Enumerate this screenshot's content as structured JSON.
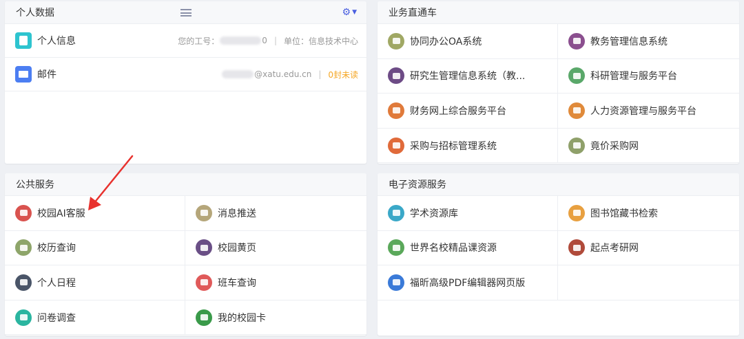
{
  "personal": {
    "title": "个人数据",
    "rows": [
      {
        "icon": "id-card-icon",
        "label": "个人信息",
        "id_prefix": "您的工号：",
        "id_tail": "0",
        "sep": "|",
        "dept": "单位：信息技术中心"
      },
      {
        "icon": "mail-icon",
        "label": "邮件",
        "email_tail": "@xatu.edu.cn",
        "sep": "|",
        "unread": "0封未读"
      }
    ]
  },
  "express": {
    "title": "业务直通车",
    "items": [
      {
        "label": "协同办公OA系统",
        "icon": "briefcase-icon",
        "color": "#a0a864"
      },
      {
        "label": "教务管理信息系统",
        "icon": "monitor-icon",
        "color": "#8b4f8f"
      },
      {
        "label": "研究生管理信息系统（教...",
        "icon": "monitor-icon",
        "color": "#6d4b86"
      },
      {
        "label": "科研管理与服务平台",
        "icon": "research-icon",
        "color": "#5aa86a"
      },
      {
        "label": "财务网上综合服务平台",
        "icon": "finance-icon",
        "color": "#e07a3a"
      },
      {
        "label": "人力资源管理与服务平台",
        "icon": "hr-icon",
        "color": "#e08a3a"
      },
      {
        "label": "采购与招标管理系统",
        "icon": "purchase-icon",
        "color": "#e06a3a"
      },
      {
        "label": "竟价采购网",
        "icon": "bid-icon",
        "color": "#8fa06a"
      }
    ]
  },
  "public": {
    "title": "公共服务",
    "items": [
      {
        "label": "校园AI客服",
        "icon": "ai-service-icon",
        "color": "#d9534f"
      },
      {
        "label": "消息推送",
        "icon": "message-icon",
        "color": "#b5a67a"
      },
      {
        "label": "校历查询",
        "icon": "calendar-icon",
        "color": "#8ea56a"
      },
      {
        "label": "校园黄页",
        "icon": "yellow-pages-icon",
        "color": "#6a4f86"
      },
      {
        "label": "个人日程",
        "icon": "schedule-icon",
        "color": "#4a5568"
      },
      {
        "label": "班车查询",
        "icon": "bus-icon",
        "color": "#e05a5a"
      },
      {
        "label": "问卷调查",
        "icon": "survey-icon",
        "color": "#2bb5a0"
      },
      {
        "label": "我的校园卡",
        "icon": "campus-card-icon",
        "color": "#3a9a4a"
      }
    ]
  },
  "eres": {
    "title": "电子资源服务",
    "items": [
      {
        "label": "学术资源库",
        "icon": "academic-db-icon",
        "color": "#3aa8c8"
      },
      {
        "label": "图书馆藏书检索",
        "icon": "library-search-icon",
        "color": "#e8a040"
      },
      {
        "label": "世界名校精品课资源",
        "icon": "course-icon",
        "color": "#5aa85a"
      },
      {
        "label": "起点考研网",
        "icon": "exam-icon",
        "color": "#b04a3a"
      },
      {
        "label": "福昕高级PDF编辑器网页版",
        "icon": "pdf-editor-icon",
        "color": "#3a7ad8"
      },
      {
        "label": "",
        "icon": "",
        "color": ""
      }
    ]
  }
}
